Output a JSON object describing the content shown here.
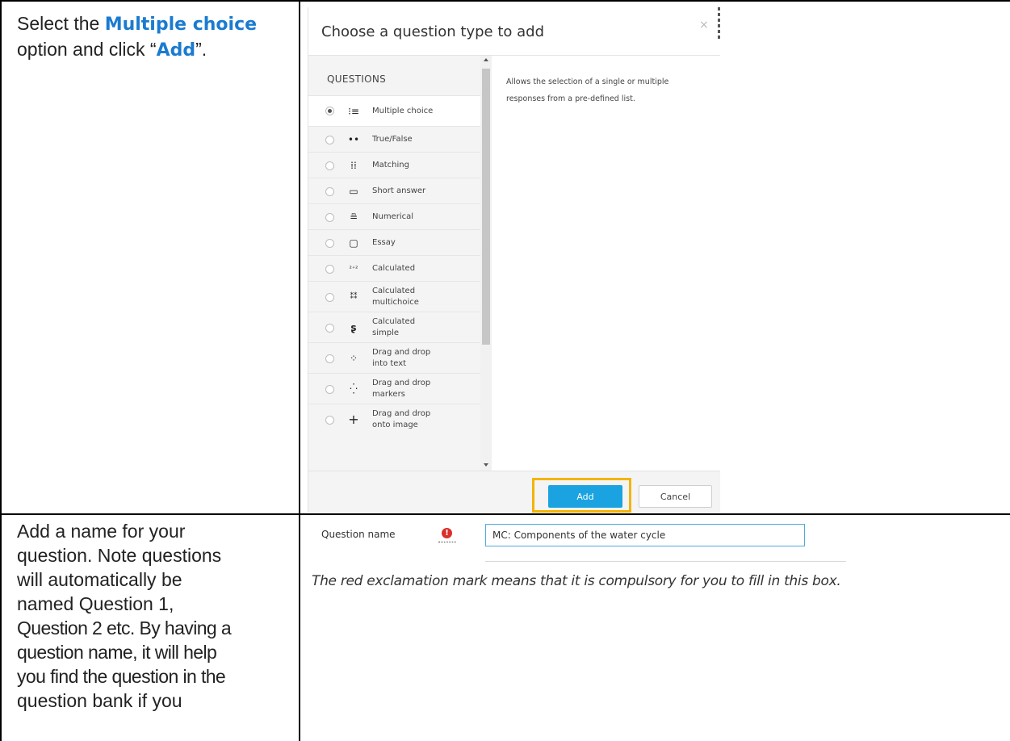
{
  "row1": {
    "instruction_prefix": "Select the ",
    "instruction_highlight": "Multiple choice",
    "instruction_line2_prefix": "option and click “",
    "instruction_line2_highlight": "Add",
    "instruction_line2_suffix": "”."
  },
  "dialog": {
    "title": "Choose a question type to add",
    "close_label": "×",
    "questions_heading": "QUESTIONS",
    "description": "Allows the selection of a single or multiple responses from a pre-defined list.",
    "add_label": "Add",
    "cancel_label": "Cancel",
    "questions": [
      {
        "label": "Multiple choice",
        "icon": "multiple-choice-icon",
        "selected": true
      },
      {
        "label": "True/False",
        "icon": "true-false-icon",
        "selected": false
      },
      {
        "label": "Matching",
        "icon": "matching-icon",
        "selected": false
      },
      {
        "label": "Short answer",
        "icon": "short-answer-icon",
        "selected": false
      },
      {
        "label": "Numerical",
        "icon": "numerical-icon",
        "selected": false
      },
      {
        "label": "Essay",
        "icon": "essay-icon",
        "selected": false
      },
      {
        "label": "Calculated",
        "icon": "calculated-icon",
        "selected": false
      },
      {
        "label": "Calculated multichoice",
        "icon": "calculated-multichoice-icon",
        "selected": false
      },
      {
        "label": "Calculated simple",
        "icon": "calculated-simple-icon",
        "selected": false
      },
      {
        "label": "Drag and drop into text",
        "icon": "drag-drop-text-icon",
        "selected": false
      },
      {
        "label": "Drag and drop markers",
        "icon": "drag-drop-markers-icon",
        "selected": false
      },
      {
        "label": "Drag and drop onto image",
        "icon": "drag-drop-image-icon",
        "selected": false
      }
    ]
  },
  "row2": {
    "instruction_lines": [
      "Add a name for your",
      "question. Note questions",
      "will automatically be",
      "named Question 1,",
      "Question 2 etc. By having a",
      "question name, it will help",
      "you find the question in the",
      "question bank if you"
    ],
    "question_name_label": "Question name",
    "question_name_value": "MC: Components of the water cycle",
    "required_mark": "!",
    "note": "The red exclamation mark means that it is compulsory for you to fill in this box."
  },
  "colors": {
    "highlight_text": "#1a7bd0",
    "add_button": "#1aa3e0",
    "add_highlight_box": "#f4b400",
    "required_icon": "#d9302c"
  }
}
